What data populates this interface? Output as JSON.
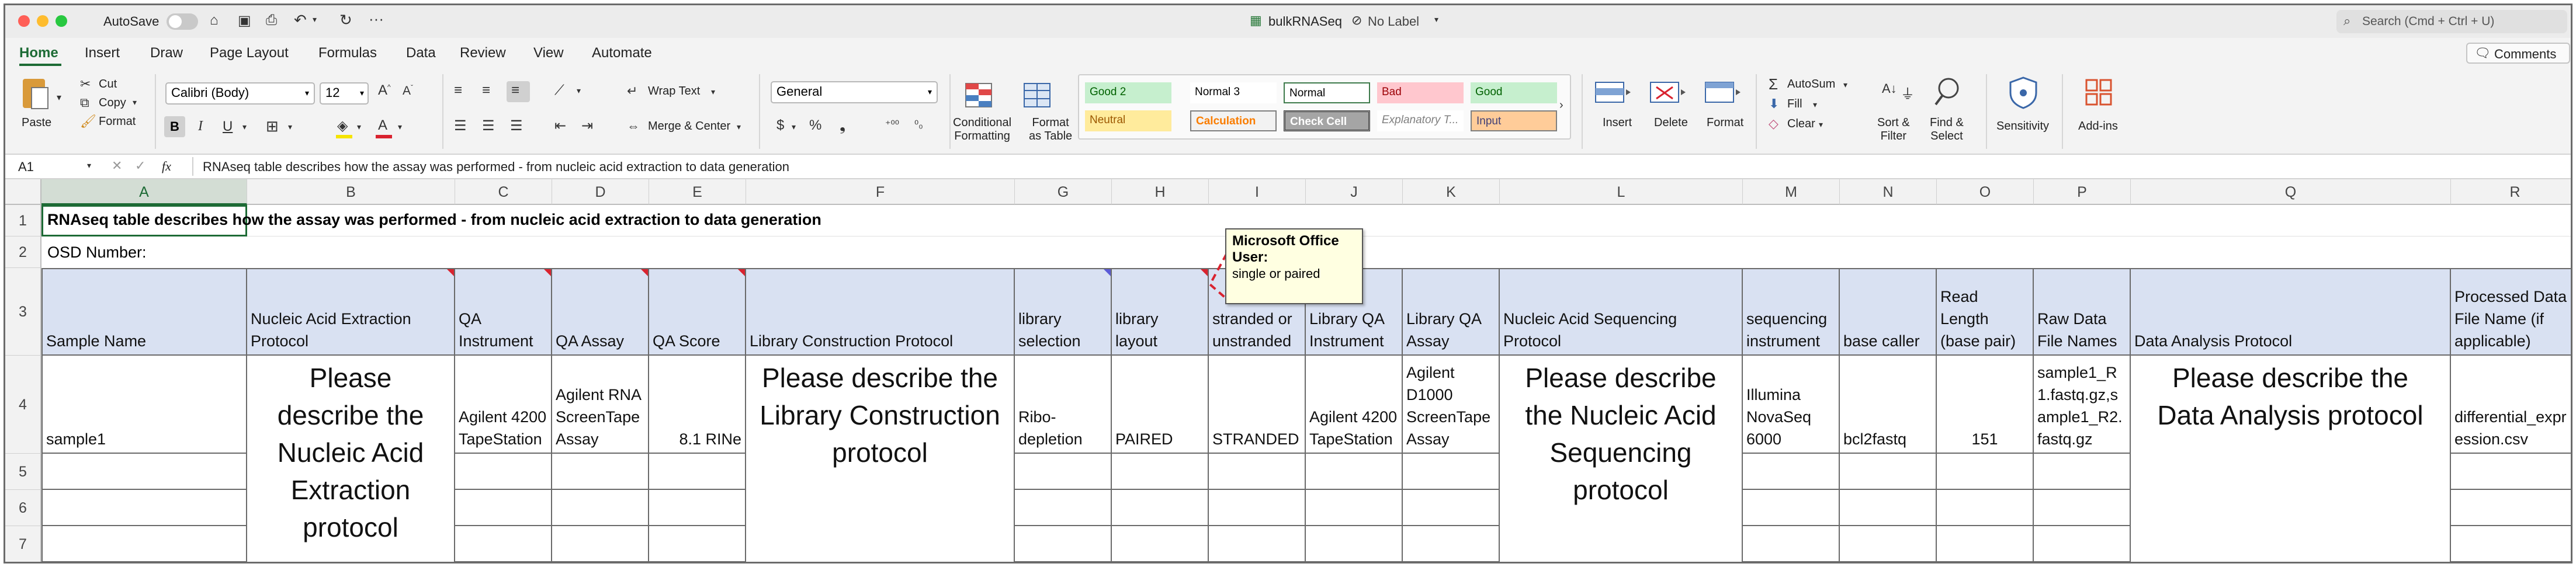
{
  "window": {
    "autosave_label": "AutoSave",
    "title": "bulkRNASeq",
    "label_status": "No Label",
    "search_placeholder": "Search (Cmd + Ctrl + U)"
  },
  "ribbon": {
    "tabs": [
      "Home",
      "Insert",
      "Draw",
      "Page Layout",
      "Formulas",
      "Data",
      "Review",
      "View",
      "Automate"
    ],
    "comments_label": "Comments",
    "paste_label": "Paste",
    "cut_label": "Cut",
    "copy_label": "Copy",
    "format_label": "Format",
    "font_name": "Calibri (Body)",
    "font_size": "12",
    "wrap_text_label": "Wrap Text",
    "merge_center_label": "Merge & Center",
    "number_format": "General",
    "cond_format_label": [
      "Conditional",
      "Formatting"
    ],
    "format_table_label": [
      "Format",
      "as Table"
    ],
    "styles": [
      {
        "name": "Good 2",
        "bg": "#c6efce",
        "fg": "#006100"
      },
      {
        "name": "Normal 3",
        "bg": "#ffffff",
        "fg": "#000000"
      },
      {
        "name": "Normal",
        "bg": "#ffffff",
        "fg": "#000000"
      },
      {
        "name": "Bad",
        "bg": "#ffc7ce",
        "fg": "#9c0006"
      },
      {
        "name": "Good",
        "bg": "#c6efce",
        "fg": "#006100"
      },
      {
        "name": "Neutral",
        "bg": "#ffeb9c",
        "fg": "#9c5700"
      },
      {
        "name": "Calculation",
        "bg": "#f2f2f2",
        "fg": "#fa7d00"
      },
      {
        "name": "Check Cell",
        "bg": "#a5a5a5",
        "fg": "#ffffff"
      },
      {
        "name": "Explanatory T...",
        "bg": "#ffffff",
        "fg": "#7f7f7f"
      },
      {
        "name": "Input",
        "bg": "#ffcc99",
        "fg": "#3f3f76"
      }
    ],
    "insert_label": "Insert",
    "delete_label": "Delete",
    "format_cells_label": "Format",
    "autosum_label": "AutoSum",
    "fill_label": "Fill",
    "clear_label": "Clear",
    "sort_filter_label": [
      "Sort &",
      "Filter"
    ],
    "find_select_label": [
      "Find &",
      "Select"
    ],
    "sensitivity_label": "Sensitivity",
    "addins_label": "Add-ins"
  },
  "formula_bar": {
    "cell_ref": "A1",
    "fx": "fx",
    "content": "RNAseq table describes how the assay was performed - from nucleic acid extraction to data generation"
  },
  "sheet": {
    "columns": [
      "A",
      "B",
      "C",
      "D",
      "E",
      "F",
      "G",
      "H",
      "I",
      "J",
      "K",
      "L",
      "M",
      "N",
      "O",
      "P",
      "Q",
      "R"
    ],
    "rows": [
      "1",
      "2",
      "3",
      "4",
      "5",
      "6",
      "7"
    ],
    "row1_title": "RNAseq table describes how the assay was performed - from nucleic acid extraction to data generation",
    "row2_label": "OSD Number:",
    "headers": {
      "A": "Sample Name",
      "B": "Nucleic Acid Extraction Protocol",
      "C": "QA Instrument",
      "D": "QA Assay",
      "E": "QA Score",
      "F": "Library Construction Protocol",
      "G": "library selection",
      "H": "library layout",
      "I": "stranded or unstranded",
      "J": "Library QA Instrument",
      "K": "Library QA Assay",
      "L": "Nucleic Acid Sequencing Protocol",
      "M": "sequencing instrument",
      "N": "base caller",
      "O": "Read Length (base pair)",
      "P": "Raw Data File Names",
      "Q": "Data Analysis Protocol",
      "R": "Processed Data File Name (if applicable)"
    },
    "row4": {
      "A": "sample1",
      "C": "Agilent 4200 TapeStation",
      "D": "Agilent RNA ScreenTape Assay",
      "E": "8.1 RINe",
      "G": "Ribo-depletion",
      "H": "PAIRED",
      "I": "STRANDED",
      "J": "Agilent 4200 TapeStation",
      "K": "Agilent D1000 ScreenTape Assay",
      "M": "Illumina NovaSeq 6000",
      "N": "bcl2fastq",
      "O": "151",
      "P": "sample1_R1.fastq.gz,sample1_R2.fastq.gz",
      "R": "differential_expression.csv"
    },
    "merged": {
      "B": "Please describe the Nucleic Acid Extraction protocol",
      "F": "Please describe the Library Construction protocol",
      "L": "Please describe the Nucleic Acid Sequencing protocol",
      "Q": "Please describe the Data Analysis protocol"
    },
    "comment": {
      "author": "Microsoft Office User:",
      "text": "single or paired"
    }
  }
}
